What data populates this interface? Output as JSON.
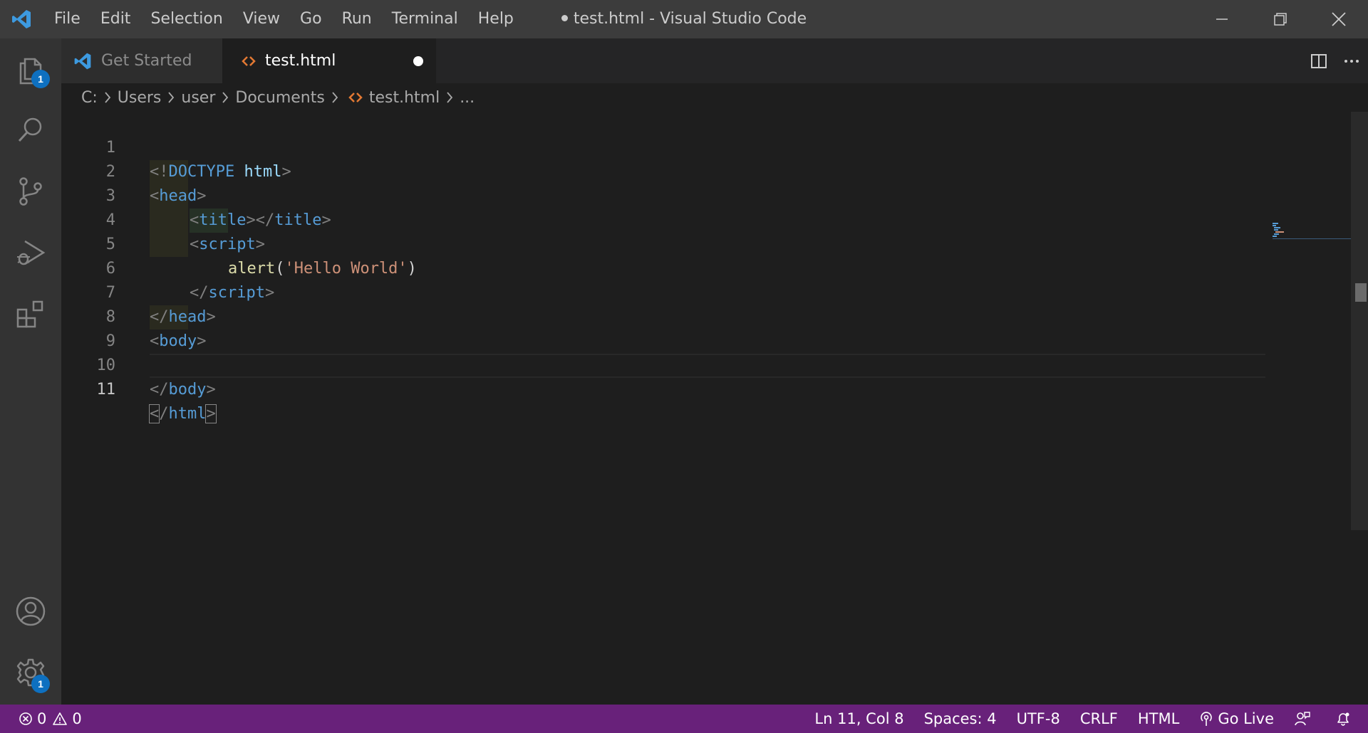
{
  "titlebar": {
    "menus": [
      "File",
      "Edit",
      "Selection",
      "View",
      "Go",
      "Run",
      "Terminal",
      "Help"
    ],
    "title": "test.html - Visual Studio Code"
  },
  "activitybar": {
    "explorer_badge": "1",
    "settings_badge": "1",
    "icons": [
      "files-icon",
      "search-icon",
      "source-control-icon",
      "run-debug-icon",
      "extensions-icon",
      "account-icon",
      "gear-icon"
    ]
  },
  "tabs": [
    {
      "label": "Get Started",
      "active": false
    },
    {
      "label": "test.html",
      "active": true,
      "dirty": true
    }
  ],
  "breadcrumb": {
    "drive": "C:",
    "folder1": "Users",
    "folder2": "user",
    "folder3": "Documents",
    "file": "test.html",
    "more": "..."
  },
  "editor": {
    "current_line": 11,
    "line_numbers": [
      "1",
      "2",
      "3",
      "4",
      "5",
      "6",
      "7",
      "8",
      "9",
      "10",
      "11"
    ],
    "lines": [
      {
        "t1": "<!",
        "t2": "DOCTYPE",
        "t3": " html",
        "t4": ">"
      },
      {
        "t1": "<",
        "t2": "head",
        "t3": ">"
      },
      {
        "t1": "<",
        "t2": "title",
        "t3": "></",
        "t4": "title",
        "t5": ">"
      },
      {
        "t1": "<",
        "t2": "script",
        "t3": ">"
      },
      {
        "t1": "alert",
        "t2": "(",
        "t3": "'Hello World'",
        "t4": ")"
      },
      {
        "t1": "</",
        "t2": "script",
        "t3": ">"
      },
      {
        "t1": "</",
        "t2": "head",
        "t3": ">"
      },
      {
        "t1": "<",
        "t2": "body",
        "t3": ">"
      },
      {},
      {
        "t1": "</",
        "t2": "body",
        "t3": ">"
      },
      {
        "t1": "<",
        "t1b": "/",
        "t2": "html",
        "t3": ">"
      }
    ]
  },
  "statusbar": {
    "errors": "0",
    "warnings": "0",
    "position": "Ln 11, Col 8",
    "spaces": "Spaces: 4",
    "encoding": "UTF-8",
    "eol": "CRLF",
    "language": "HTML",
    "go_live": "Go Live"
  },
  "colors": {
    "statusbar_bg": "#68217a",
    "accent": "#0e70c0",
    "tag": "#569cd6",
    "string": "#ce9178",
    "function": "#dcdcaa"
  }
}
